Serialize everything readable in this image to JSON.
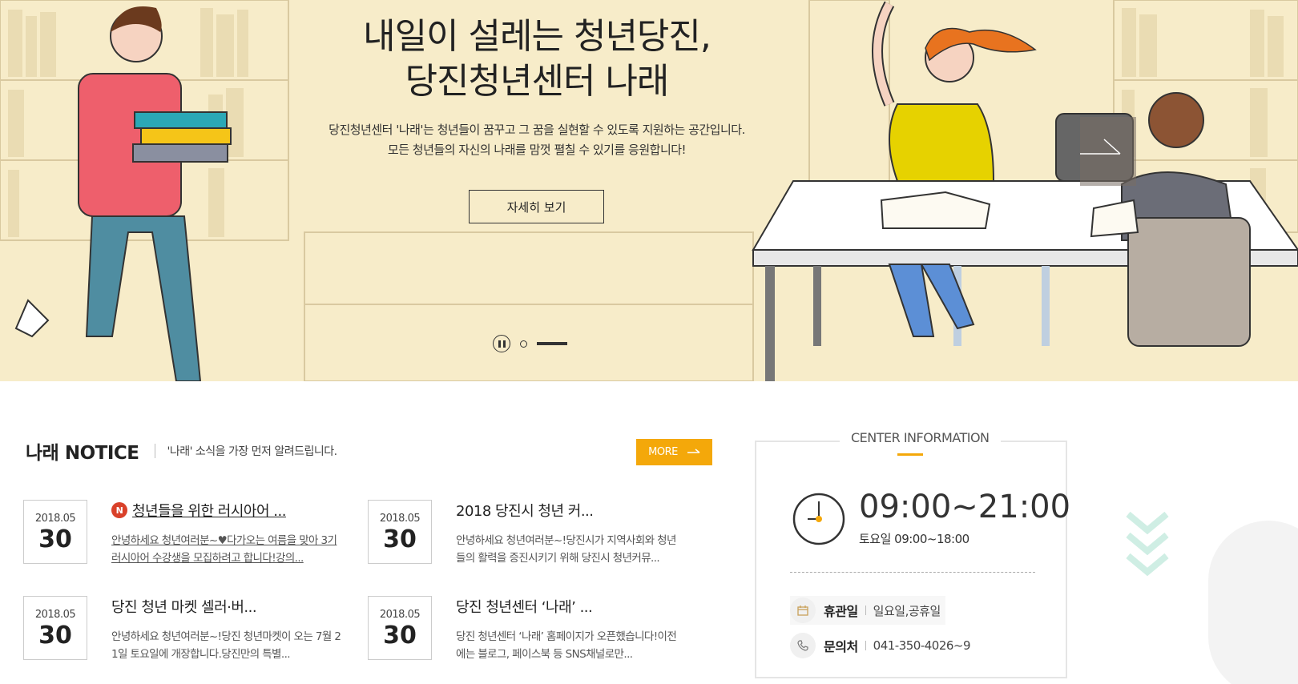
{
  "hero": {
    "title_line1": "내일이 설레는 청년당진,",
    "title_line2": "당진청년센터 나래",
    "desc_line1": "당진청년센터 '나래'는 청년들이 꿈꾸고 그 꿈을 실현할 수 있도록 지원하는 공간입니다.",
    "desc_line2": "모든 청년들의 자신의 나래를 맘껏 펼칠 수 있기를 응원합니다!",
    "button_label": "자세히 보기"
  },
  "notice": {
    "title": "나래 NOTICE",
    "subtitle": "'나래' 소식을 가장 먼저 알려드립니다.",
    "more_label": "MORE",
    "items": [
      {
        "ym": "2018.05",
        "day": "30",
        "badge": "N",
        "title": "청년들을 위한 러시아어 ...",
        "desc_line1": "안녕하세요 청년여러분~♥다가오는 여름을 맞아 3기",
        "desc_line2": "러시아어 수강생을 모집하려고 합니다!강의..."
      },
      {
        "ym": "2018.05",
        "day": "30",
        "title": "2018 당진시 청년 커...",
        "desc_line1": "안녕하세요 청년여러분~!당진시가 지역사회와 청년",
        "desc_line2": "들의 활력을 증진시키기 위해 당진시 청년커뮤..."
      },
      {
        "ym": "2018.05",
        "day": "30",
        "title": "당진 청년 마켓 셀러·버...",
        "desc_line1": "안녕하세요 청년여러분~!당진 청년마켓이 오는 7월 2",
        "desc_line2": "1일 토요일에 개장합니다.당진만의 특별..."
      },
      {
        "ym": "2018.05",
        "day": "30",
        "title": "당진 청년센터 ‘나래’ ...",
        "desc_line1": "당진 청년센터 ‘나래’ 홈페이지가 오픈했습니다!이전",
        "desc_line2": "에는 블로그, 페이스북 등 SNS채널로만..."
      }
    ]
  },
  "center": {
    "title": "CENTER INFORMATION",
    "hours": "09:00~21:00",
    "saturday": "토요일 09:00~18:00",
    "closed_label": "휴관일",
    "closed_value": "일요일,공휴일",
    "contact_label": "문의처",
    "contact_value": "041-350-4026~9"
  },
  "colors": {
    "accent": "#f4a80a",
    "hero_bg": "#f7ecc9",
    "new_badge": "#d9412a"
  },
  "icons": [
    "pause-icon",
    "arrow-right-icon",
    "clock-icon",
    "calendar-icon",
    "phone-icon",
    "chevron-down-icon"
  ]
}
